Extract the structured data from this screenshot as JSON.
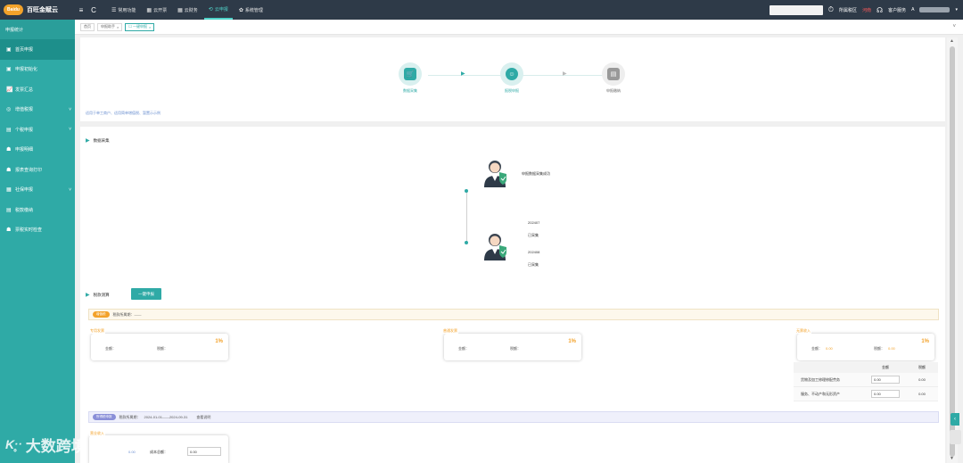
{
  "app": {
    "logo_badge": "Baidu",
    "logo_text": "百旺金赋云"
  },
  "topbar": {
    "nav": [
      {
        "icon": "☰",
        "label": "常用功能"
      },
      {
        "icon": "▦",
        "label": "云开票"
      },
      {
        "icon": "▦",
        "label": "云财务"
      },
      {
        "icon": "⟲",
        "label": "云申报"
      },
      {
        "icon": "✿",
        "label": "系统管理"
      }
    ],
    "region_label": "所属税区",
    "region_badge": "河南",
    "service_label": "客户服务",
    "user_prefix": "A"
  },
  "sidebar": {
    "title": "申报统计",
    "items": [
      {
        "icon": "▣",
        "label": "首页申报",
        "arrow": ""
      },
      {
        "icon": "▣",
        "label": "申报初始化",
        "arrow": ""
      },
      {
        "icon": "📈",
        "label": "发票汇总",
        "arrow": ""
      },
      {
        "icon": "◎",
        "label": "增值税报",
        "arrow": "˅"
      },
      {
        "icon": "▤",
        "label": "个税申报",
        "arrow": "˅"
      },
      {
        "icon": "☗",
        "label": "申报明细",
        "arrow": ""
      },
      {
        "icon": "☗",
        "label": "报表查询打印",
        "arrow": ""
      },
      {
        "icon": "▦",
        "label": "社保申报",
        "arrow": "˅"
      },
      {
        "icon": "▤",
        "label": "税款缴纳",
        "arrow": ""
      },
      {
        "icon": "☗",
        "label": "票税实时检查",
        "arrow": ""
      }
    ]
  },
  "tabs": [
    {
      "label": "首页",
      "close": ""
    },
    {
      "label": "申报助手",
      "close": "×"
    },
    {
      "label": "☐ 一键申报",
      "close": "×"
    }
  ],
  "steps": [
    {
      "label": "数据采集"
    },
    {
      "label": "报税申报"
    },
    {
      "label": "申报缴纳"
    }
  ],
  "hint_link": "适用于单工商户、适用简单增值税、暂置示示例",
  "sections": {
    "collect_title": "数据采集",
    "declare_title": "税款测算",
    "one_click_button": "一键申报"
  },
  "timeline": {
    "top_text": "申报数据采集成功",
    "entries": [
      {
        "period": "202407",
        "status": "已采集"
      },
      {
        "period": "202408",
        "status": "已采集"
      }
    ]
  },
  "vat_bar": {
    "pill": "增值税",
    "text": "税款所属期：——"
  },
  "cards": [
    {
      "legend": "专用发票",
      "pct": "1%",
      "amount_label": "金额：",
      "tax_label": "税额："
    },
    {
      "legend": "普通发票",
      "pct": "1%",
      "amount_label": "金额：",
      "tax_label": "税额："
    },
    {
      "legend": "无票收入",
      "pct": "1%",
      "amount_label": "金额：",
      "amount_value": "0.00",
      "tax_label": "税额：",
      "tax_value": "0.00"
    }
  ],
  "mini_table": {
    "headers": [
      "金额",
      "税额"
    ],
    "rows": [
      {
        "label": "货物及加工修理修配劳务",
        "amount": "0.00",
        "tax": "0.00"
      },
      {
        "label": "服务、不动产和无形资产",
        "amount": "0.00",
        "tax": "0.00"
      }
    ]
  },
  "income_bar": {
    "pill": "所得税申报",
    "period_label": "税款所属期：",
    "period": "2024-01-01——2024-09-31",
    "link": "查看说明"
  },
  "bottom_card": {
    "legend": "营业收入",
    "income_value": "0.00",
    "cost_label": "成本总额：",
    "cost_value": "0.00"
  },
  "watermark": {
    "logo": "Kᐧ̥ᐧ",
    "text": "大数跨境"
  },
  "colors": {
    "topbar": "#2e3a48",
    "sidebar": "#2faaa6",
    "accent": "#2faaa6",
    "orange": "#f3a22a"
  }
}
